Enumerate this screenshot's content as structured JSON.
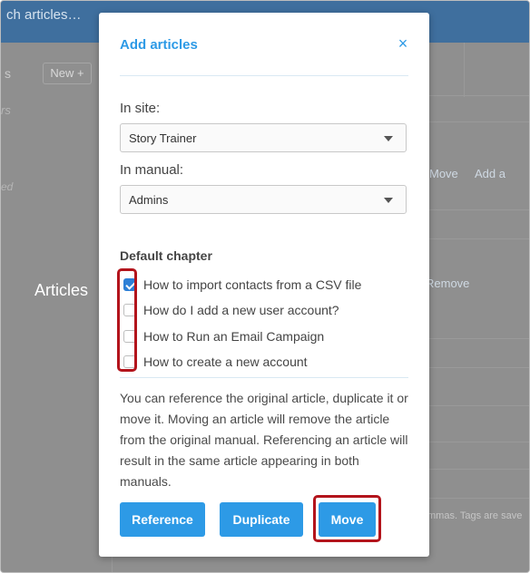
{
  "background": {
    "search_text": "ch articles…",
    "new_button": "New +",
    "s_label": "s",
    "rs_label": "rs",
    "ed_label": "ed",
    "move_link": "Move",
    "add_link": "Add a",
    "remove_link": "Remove",
    "tags_hint": "mmas. Tags are save"
  },
  "annotation": {
    "label": "Articles"
  },
  "modal": {
    "title": "Add articles",
    "close": "×",
    "site_label": "In site:",
    "site_value": "Story Trainer",
    "manual_label": "In manual:",
    "manual_value": "Admins",
    "chapter_heading": "Default chapter",
    "articles": [
      {
        "label": "How to import contacts from a CSV file",
        "checked": true
      },
      {
        "label": "How do I add a new user account?",
        "checked": false
      },
      {
        "label": "How to Run an Email Campaign",
        "checked": false
      },
      {
        "label": "How to create a new account",
        "checked": false
      }
    ],
    "description": "You can reference the original article, duplicate it or move it. Moving an article will remove the article from the original manual. Referencing an article will result in the same article appearing in both manuals.",
    "buttons": {
      "reference": "Reference",
      "duplicate": "Duplicate",
      "move": "Move"
    }
  },
  "colors": {
    "accent": "#2d9ae6",
    "highlight": "#b3141c",
    "overlay": "#8f8f8f"
  }
}
